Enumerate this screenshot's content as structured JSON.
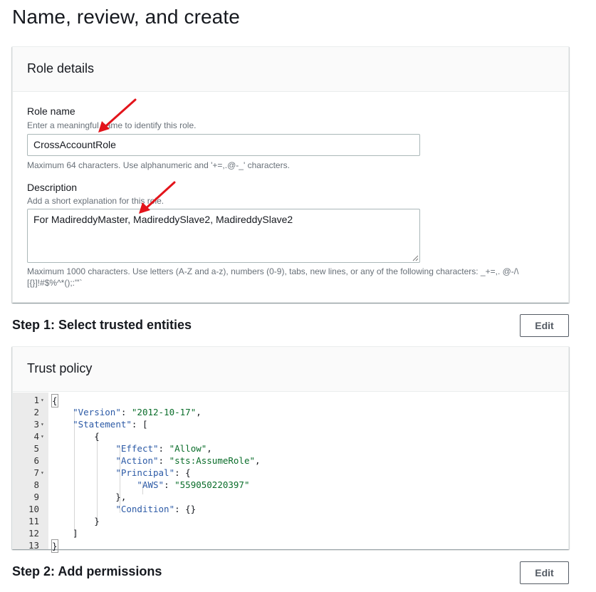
{
  "page": {
    "title": "Name, review, and create"
  },
  "role_details": {
    "header": "Role details",
    "role_name": {
      "label": "Role name",
      "hint": "Enter a meaningful name to identify this role.",
      "value": "CrossAccountRole",
      "constraint": "Maximum 64 characters. Use alphanumeric and '+=,.@-_' characters."
    },
    "description": {
      "label": "Description",
      "hint": "Add a short explanation for this role.",
      "value": "For MadireddyMaster, MadireddySlave2, MadireddySlave2",
      "constraint_line1": "Maximum 1000 characters. Use letters (A-Z and a-z), numbers (0-9), tabs, new lines, or any of the following characters: _+=,. @-/\\",
      "constraint_line2": "[{}]!#$%^*();:'\"`"
    }
  },
  "step1": {
    "title": "Step 1: Select trusted entities",
    "edit_label": "Edit"
  },
  "trust_policy": {
    "header": "Trust policy",
    "lines": [
      {
        "n": "1",
        "fold": true
      },
      {
        "n": "2",
        "fold": false
      },
      {
        "n": "3",
        "fold": true
      },
      {
        "n": "4",
        "fold": true
      },
      {
        "n": "5",
        "fold": false
      },
      {
        "n": "6",
        "fold": false
      },
      {
        "n": "7",
        "fold": true
      },
      {
        "n": "8",
        "fold": false
      },
      {
        "n": "9",
        "fold": false
      },
      {
        "n": "10",
        "fold": false
      },
      {
        "n": "11",
        "fold": false
      },
      {
        "n": "12",
        "fold": false
      },
      {
        "n": "13",
        "fold": false
      }
    ],
    "json": {
      "version_key": "\"Version\"",
      "version_val": "\"2012-10-17\"",
      "statement_key": "\"Statement\"",
      "effect_key": "\"Effect\"",
      "effect_val": "\"Allow\"",
      "action_key": "\"Action\"",
      "action_val": "\"sts:AssumeRole\"",
      "principal_key": "\"Principal\"",
      "aws_key": "\"AWS\"",
      "aws_val": "\"559050220397\"",
      "condition_key": "\"Condition\""
    }
  },
  "step2": {
    "title": "Step 2: Add permissions",
    "edit_label": "Edit"
  },
  "colors": {
    "annotation_arrow": "#e3141b",
    "json_key": "#2c5aa6",
    "json_string": "#0a6d2a"
  }
}
